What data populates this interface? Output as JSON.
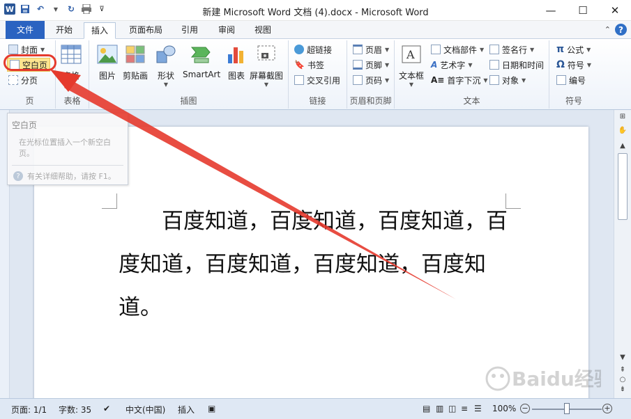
{
  "window": {
    "title": "新建 Microsoft Word 文档 (4).docx - Microsoft Word",
    "minimize": "—",
    "maximize": "☐",
    "close": "✕"
  },
  "tabs": [
    {
      "label": "文件"
    },
    {
      "label": "开始"
    },
    {
      "label": "插入"
    },
    {
      "label": "页面布局"
    },
    {
      "label": "引用"
    },
    {
      "label": "审阅"
    },
    {
      "label": "视图"
    }
  ],
  "ribbon": {
    "pages": {
      "label": "页",
      "cover": "封面",
      "blank": "空白页",
      "page_break": "分页"
    },
    "tables": {
      "label": "表格",
      "table": "表格"
    },
    "illustrations": {
      "label": "插图",
      "picture": "图片",
      "clipart": "剪贴画",
      "shapes": "形状",
      "smartart": "SmartArt",
      "chart": "图表",
      "screenshot": "屏幕截图"
    },
    "links": {
      "label": "链接",
      "hyperlink": "超链接",
      "bookmark": "书签",
      "crossref": "交叉引用"
    },
    "header_footer": {
      "label": "页眉和页脚",
      "header": "页眉",
      "footer": "页脚",
      "page_number": "页码"
    },
    "text": {
      "label": "文本",
      "textbox": "文本框",
      "quick_parts": "文档部件",
      "wordart": "艺术字",
      "dropcap": "首字下沉",
      "signature": "签名行",
      "datetime": "日期和时间",
      "object": "对象"
    },
    "symbols": {
      "label": "符号",
      "equation": "公式",
      "symbol": "符号",
      "number": "编号"
    }
  },
  "tooltip": {
    "title": "空白页",
    "body": "在光标位置插入一个新空白页。",
    "help": "有关详细帮助，请按 F1。"
  },
  "document": {
    "text": "百度知道，百度知道，百度知道，百度知道，百度知道，百度知道，百度知道。"
  },
  "statusbar": {
    "page": "页面: 1/1",
    "words": "字数: 35",
    "language": "中文(中国)",
    "mode": "插入",
    "zoom": "100%",
    "zoom_level": 1.0
  },
  "watermark": {
    "text": "Baidu经验"
  },
  "colors": {
    "file_tab": "#2a63c1",
    "highlight": "#e53a2d",
    "ribbon_bg": "#eef3fa"
  }
}
